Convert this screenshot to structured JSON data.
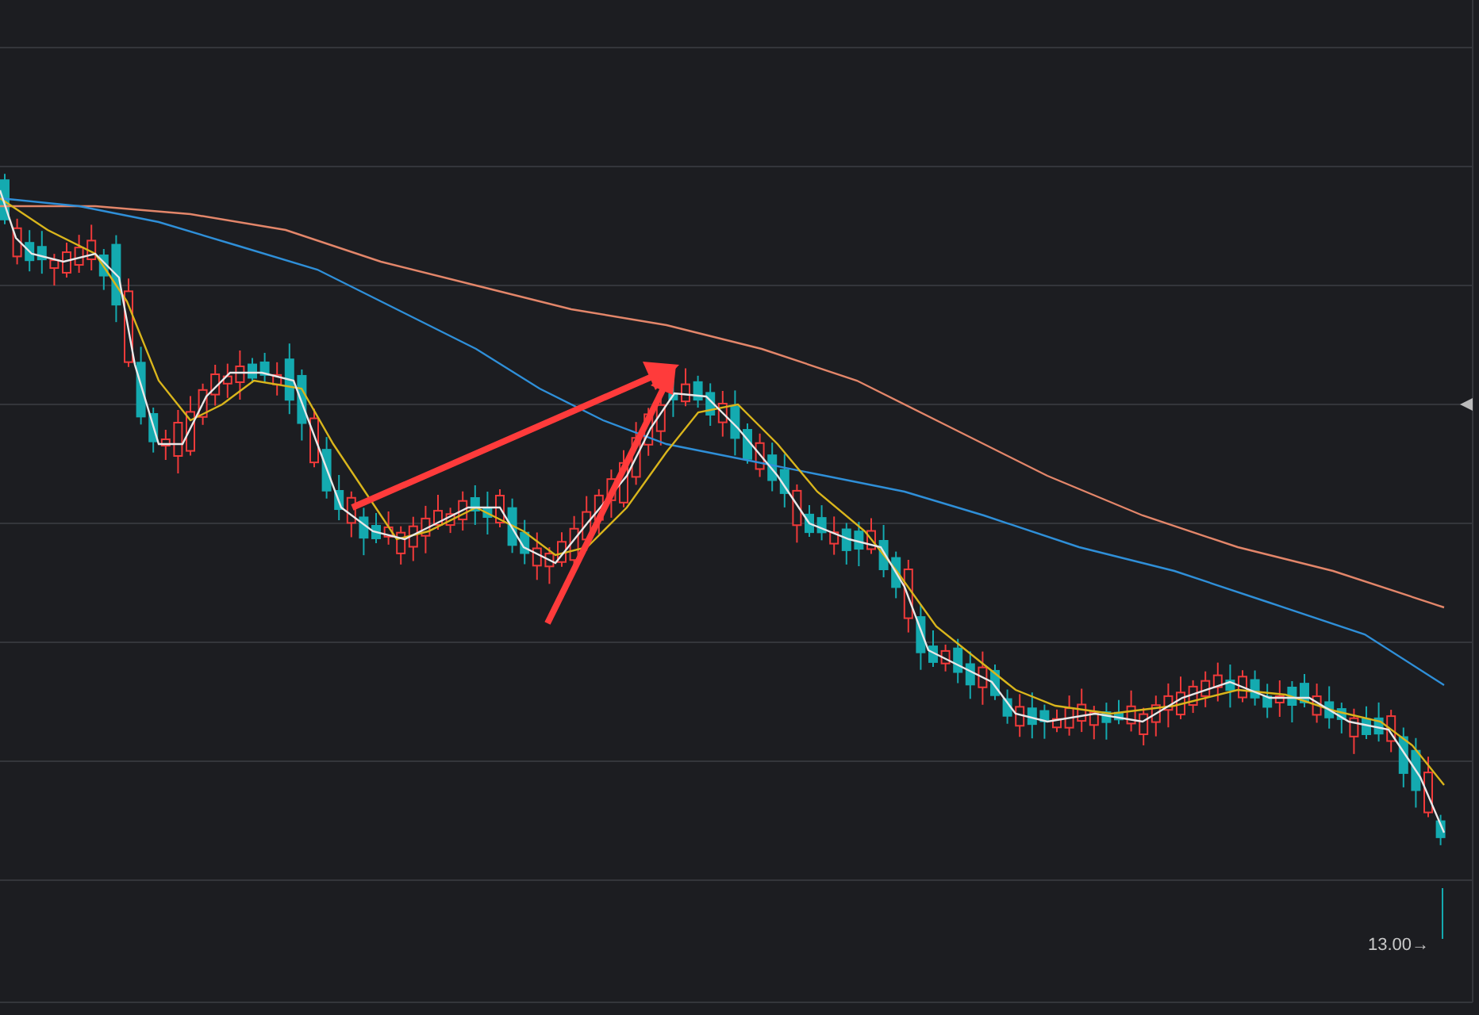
{
  "chart": {
    "price_label": "13.00→"
  }
}
